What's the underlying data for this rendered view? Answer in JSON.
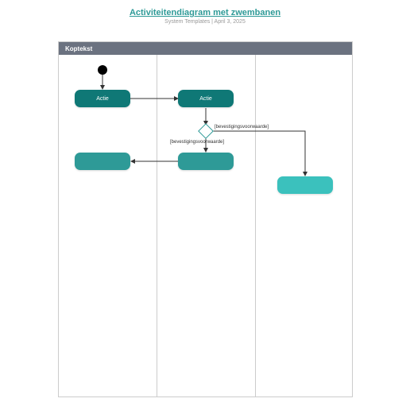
{
  "title": "Activiteitendiagram met zwembanen",
  "subtitle": "System Templates  |  April 3, 2025",
  "header_label": "Koptekst",
  "nodes": {
    "action1": "Actie",
    "action2": "Actie",
    "action3": "",
    "action4": "",
    "action5": ""
  },
  "guards": {
    "top": "[bevestigingsvoorwaarde]",
    "left": "[bevestigingsvoorwaarde]"
  }
}
